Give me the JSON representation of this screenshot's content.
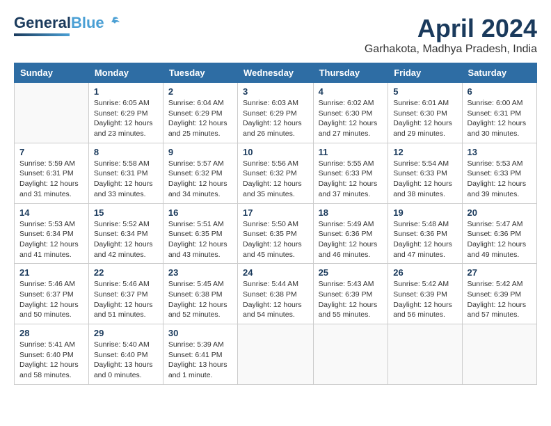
{
  "header": {
    "logo_general": "General",
    "logo_blue": "Blue",
    "title": "April 2024",
    "location": "Garhakota, Madhya Pradesh, India"
  },
  "weekdays": [
    "Sunday",
    "Monday",
    "Tuesday",
    "Wednesday",
    "Thursday",
    "Friday",
    "Saturday"
  ],
  "weeks": [
    [
      {
        "day": "",
        "info": ""
      },
      {
        "day": "1",
        "info": "Sunrise: 6:05 AM\nSunset: 6:29 PM\nDaylight: 12 hours\nand 23 minutes."
      },
      {
        "day": "2",
        "info": "Sunrise: 6:04 AM\nSunset: 6:29 PM\nDaylight: 12 hours\nand 25 minutes."
      },
      {
        "day": "3",
        "info": "Sunrise: 6:03 AM\nSunset: 6:29 PM\nDaylight: 12 hours\nand 26 minutes."
      },
      {
        "day": "4",
        "info": "Sunrise: 6:02 AM\nSunset: 6:30 PM\nDaylight: 12 hours\nand 27 minutes."
      },
      {
        "day": "5",
        "info": "Sunrise: 6:01 AM\nSunset: 6:30 PM\nDaylight: 12 hours\nand 29 minutes."
      },
      {
        "day": "6",
        "info": "Sunrise: 6:00 AM\nSunset: 6:31 PM\nDaylight: 12 hours\nand 30 minutes."
      }
    ],
    [
      {
        "day": "7",
        "info": "Sunrise: 5:59 AM\nSunset: 6:31 PM\nDaylight: 12 hours\nand 31 minutes."
      },
      {
        "day": "8",
        "info": "Sunrise: 5:58 AM\nSunset: 6:31 PM\nDaylight: 12 hours\nand 33 minutes."
      },
      {
        "day": "9",
        "info": "Sunrise: 5:57 AM\nSunset: 6:32 PM\nDaylight: 12 hours\nand 34 minutes."
      },
      {
        "day": "10",
        "info": "Sunrise: 5:56 AM\nSunset: 6:32 PM\nDaylight: 12 hours\nand 35 minutes."
      },
      {
        "day": "11",
        "info": "Sunrise: 5:55 AM\nSunset: 6:33 PM\nDaylight: 12 hours\nand 37 minutes."
      },
      {
        "day": "12",
        "info": "Sunrise: 5:54 AM\nSunset: 6:33 PM\nDaylight: 12 hours\nand 38 minutes."
      },
      {
        "day": "13",
        "info": "Sunrise: 5:53 AM\nSunset: 6:33 PM\nDaylight: 12 hours\nand 39 minutes."
      }
    ],
    [
      {
        "day": "14",
        "info": "Sunrise: 5:53 AM\nSunset: 6:34 PM\nDaylight: 12 hours\nand 41 minutes."
      },
      {
        "day": "15",
        "info": "Sunrise: 5:52 AM\nSunset: 6:34 PM\nDaylight: 12 hours\nand 42 minutes."
      },
      {
        "day": "16",
        "info": "Sunrise: 5:51 AM\nSunset: 6:35 PM\nDaylight: 12 hours\nand 43 minutes."
      },
      {
        "day": "17",
        "info": "Sunrise: 5:50 AM\nSunset: 6:35 PM\nDaylight: 12 hours\nand 45 minutes."
      },
      {
        "day": "18",
        "info": "Sunrise: 5:49 AM\nSunset: 6:36 PM\nDaylight: 12 hours\nand 46 minutes."
      },
      {
        "day": "19",
        "info": "Sunrise: 5:48 AM\nSunset: 6:36 PM\nDaylight: 12 hours\nand 47 minutes."
      },
      {
        "day": "20",
        "info": "Sunrise: 5:47 AM\nSunset: 6:36 PM\nDaylight: 12 hours\nand 49 minutes."
      }
    ],
    [
      {
        "day": "21",
        "info": "Sunrise: 5:46 AM\nSunset: 6:37 PM\nDaylight: 12 hours\nand 50 minutes."
      },
      {
        "day": "22",
        "info": "Sunrise: 5:46 AM\nSunset: 6:37 PM\nDaylight: 12 hours\nand 51 minutes."
      },
      {
        "day": "23",
        "info": "Sunrise: 5:45 AM\nSunset: 6:38 PM\nDaylight: 12 hours\nand 52 minutes."
      },
      {
        "day": "24",
        "info": "Sunrise: 5:44 AM\nSunset: 6:38 PM\nDaylight: 12 hours\nand 54 minutes."
      },
      {
        "day": "25",
        "info": "Sunrise: 5:43 AM\nSunset: 6:39 PM\nDaylight: 12 hours\nand 55 minutes."
      },
      {
        "day": "26",
        "info": "Sunrise: 5:42 AM\nSunset: 6:39 PM\nDaylight: 12 hours\nand 56 minutes."
      },
      {
        "day": "27",
        "info": "Sunrise: 5:42 AM\nSunset: 6:39 PM\nDaylight: 12 hours\nand 57 minutes."
      }
    ],
    [
      {
        "day": "28",
        "info": "Sunrise: 5:41 AM\nSunset: 6:40 PM\nDaylight: 12 hours\nand 58 minutes."
      },
      {
        "day": "29",
        "info": "Sunrise: 5:40 AM\nSunset: 6:40 PM\nDaylight: 13 hours\nand 0 minutes."
      },
      {
        "day": "30",
        "info": "Sunrise: 5:39 AM\nSunset: 6:41 PM\nDaylight: 13 hours\nand 1 minute."
      },
      {
        "day": "",
        "info": ""
      },
      {
        "day": "",
        "info": ""
      },
      {
        "day": "",
        "info": ""
      },
      {
        "day": "",
        "info": ""
      }
    ]
  ]
}
